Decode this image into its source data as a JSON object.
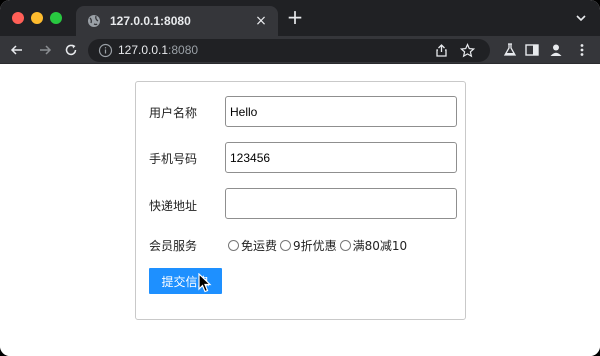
{
  "browser": {
    "tab_title": "127.0.0.1:8080",
    "url_host": "127.0.0.1",
    "url_port": ":8080",
    "icons": [
      "globe-icon",
      "close-icon",
      "plus-icon",
      "chevron-down-icon",
      "back-icon",
      "forward-icon",
      "reload-icon",
      "info-icon",
      "share-icon",
      "star-icon",
      "flask-icon",
      "sidebar-icon",
      "profile-icon",
      "kebab-menu-icon"
    ],
    "colors": {
      "tabbar": "#202124",
      "toolbar": "#35363a"
    }
  },
  "tabbar": {
    "new_tab_label": "+",
    "close_label": "×"
  },
  "form": {
    "username_label": "用户名称",
    "username_value": "Hello",
    "phone_label": "手机号码",
    "phone_value": "123456",
    "address_label": "快递地址",
    "address_value": "",
    "membership_label": "会员服务",
    "options": [
      "免运费",
      "9折优惠",
      "满80减10"
    ],
    "submit_label": "提交信息",
    "submit_color": "#1e90ff"
  }
}
